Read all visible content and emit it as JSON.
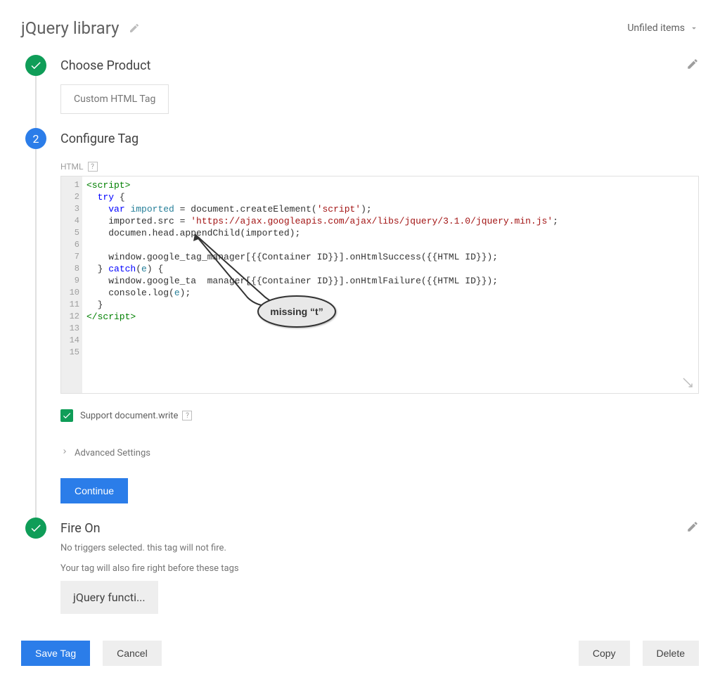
{
  "header": {
    "title": "jQuery library",
    "folder_label": "Unfiled items"
  },
  "steps": {
    "choose": {
      "title": "Choose Product",
      "selected_chip": "Custom HTML Tag"
    },
    "configure": {
      "title": "Configure Tag",
      "badge": "2",
      "html_label": "HTML",
      "editor_lines": 15,
      "code_tokens": [
        [
          {
            "t": "tag",
            "v": "<script>"
          }
        ],
        [
          {
            "t": "plain",
            "v": "  "
          },
          {
            "t": "kw",
            "v": "try"
          },
          {
            "t": "plain",
            "v": " {"
          }
        ],
        [
          {
            "t": "plain",
            "v": "    "
          },
          {
            "t": "kw",
            "v": "var"
          },
          {
            "t": "plain",
            "v": " "
          },
          {
            "t": "id",
            "v": "imported"
          },
          {
            "t": "plain",
            "v": " = document.createElement("
          },
          {
            "t": "str",
            "v": "'script'"
          },
          {
            "t": "plain",
            "v": ");"
          }
        ],
        [
          {
            "t": "plain",
            "v": "    imported.src = "
          },
          {
            "t": "str",
            "v": "'https://ajax.googleapis.com/ajax/libs/jquery/3.1.0/jquery.min.js'"
          },
          {
            "t": "plain",
            "v": ";"
          }
        ],
        [
          {
            "t": "plain",
            "v": "    documen.head.appendChild(imported);"
          }
        ],
        [],
        [
          {
            "t": "plain",
            "v": "    window.google_tag_manager[{{Container ID}}].onHtmlSuccess({{HTML ID}});"
          }
        ],
        [
          {
            "t": "plain",
            "v": "  } "
          },
          {
            "t": "kw",
            "v": "catch"
          },
          {
            "t": "plain",
            "v": "("
          },
          {
            "t": "id",
            "v": "e"
          },
          {
            "t": "plain",
            "v": ") {"
          }
        ],
        [
          {
            "t": "plain",
            "v": "    window.google_ta  manager[{{Container ID}}].onHtmlFailure({{HTML ID}});"
          }
        ],
        [
          {
            "t": "plain",
            "v": "    console.log("
          },
          {
            "t": "id",
            "v": "e"
          },
          {
            "t": "plain",
            "v": ");"
          }
        ],
        [
          {
            "t": "plain",
            "v": "  }"
          }
        ],
        [
          {
            "t": "tag",
            "v": "</script>"
          }
        ],
        [],
        [],
        []
      ],
      "callout_text": "missing “t”",
      "support_write_label": "Support document.write",
      "support_write_checked": true,
      "advanced_label": "Advanced Settings",
      "continue_label": "Continue"
    },
    "fire": {
      "title": "Fire On",
      "sub1": "No triggers selected. this tag will not fire.",
      "sub2": "Your tag will also fire right before these tags",
      "chip": "jQuery functi..."
    }
  },
  "footer": {
    "save": "Save Tag",
    "cancel": "Cancel",
    "copy": "Copy",
    "delete": "Delete"
  }
}
